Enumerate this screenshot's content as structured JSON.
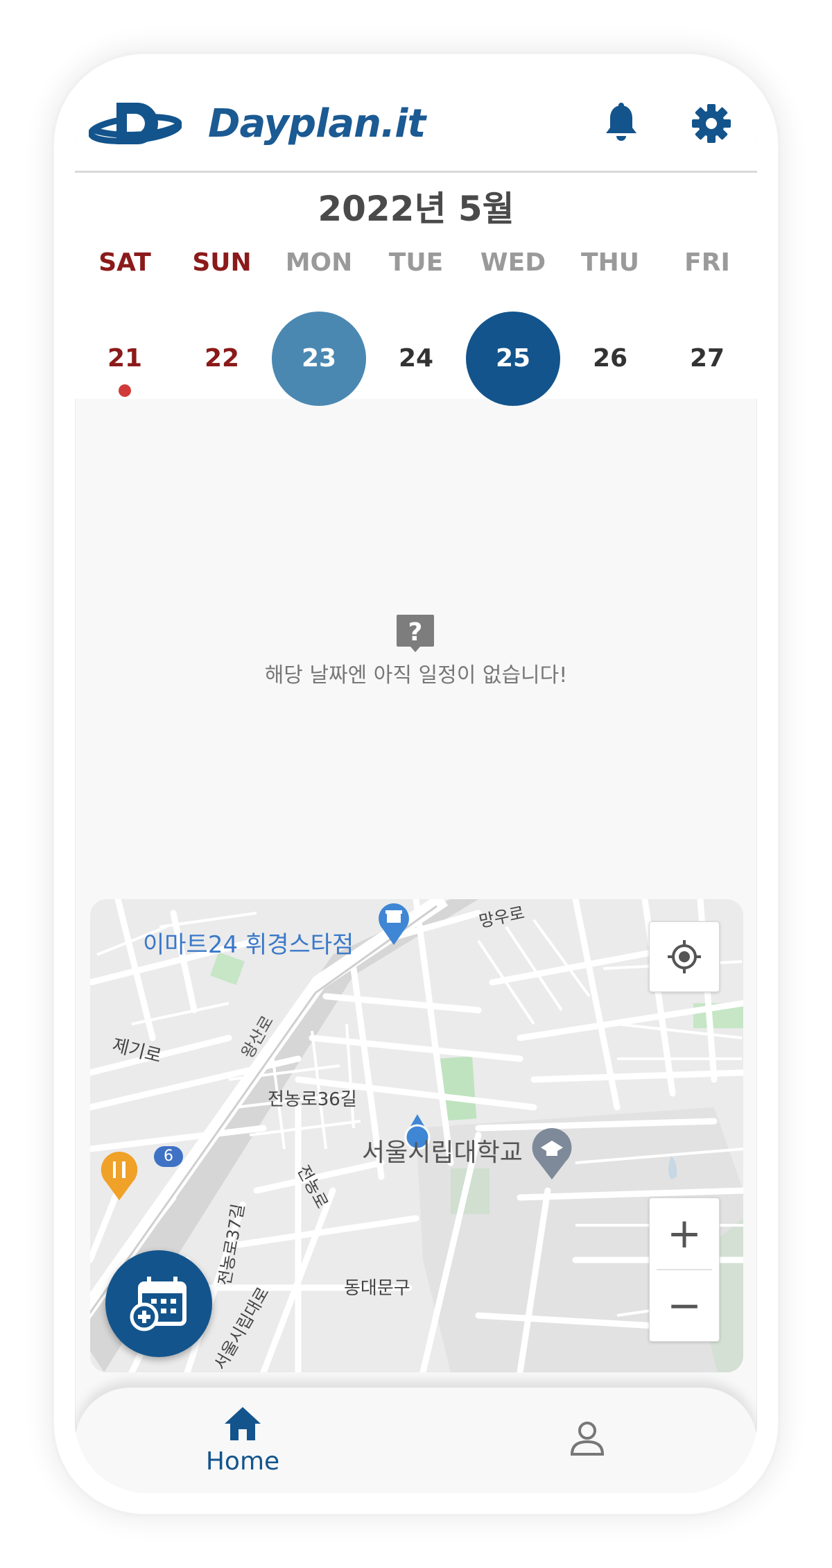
{
  "app": {
    "brand": "Dayplan.it",
    "brand_color": "#1b5a93"
  },
  "header": {
    "logo_icon": "planet-d-logo-icon",
    "notification_icon": "bell-icon",
    "settings_icon": "gear-icon"
  },
  "calendar": {
    "month_title": "2022년 5월",
    "days": [
      {
        "dow": "SAT",
        "date": "21",
        "weekend": true,
        "has_event": true
      },
      {
        "dow": "SUN",
        "date": "22",
        "weekend": true,
        "has_event": false
      },
      {
        "dow": "MON",
        "date": "23",
        "state": "today"
      },
      {
        "dow": "TUE",
        "date": "24"
      },
      {
        "dow": "WED",
        "date": "25",
        "state": "selected"
      },
      {
        "dow": "THU",
        "date": "26"
      },
      {
        "dow": "FRI",
        "date": "27"
      }
    ],
    "colors": {
      "weekend": "#8b1a1a",
      "weekday": "#9a9a9a",
      "today_circle": "#4a88b2",
      "selected_circle": "#13548c",
      "event_dot": "#d03a3a"
    }
  },
  "empty_state": {
    "icon": "question-bubble-icon",
    "message": "해당 날짜엔 아직 일정이 없습니다!"
  },
  "map": {
    "labels": {
      "store": "이마트24 휘경스타점",
      "road_wangsan": "왕산로",
      "road_jegi": "제기로",
      "road_jeonnong36": "전농로36길",
      "road_jeonnong": "전농로",
      "road_jeonnong37": "전농로37길",
      "road_siripdae": "서울시립대로",
      "road_mangu": "망우로",
      "district": "동대문구",
      "university": "서울시립대학교",
      "bus_stop": "6"
    },
    "controls": {
      "locate_icon": "crosshair-icon",
      "zoom_in": "+",
      "zoom_out": "−"
    }
  },
  "fab": {
    "icon": "calendar-add-icon",
    "color": "#13548c"
  },
  "bottom_nav": {
    "home_label": "Home",
    "home_icon": "home-icon",
    "profile_icon": "user-icon"
  }
}
